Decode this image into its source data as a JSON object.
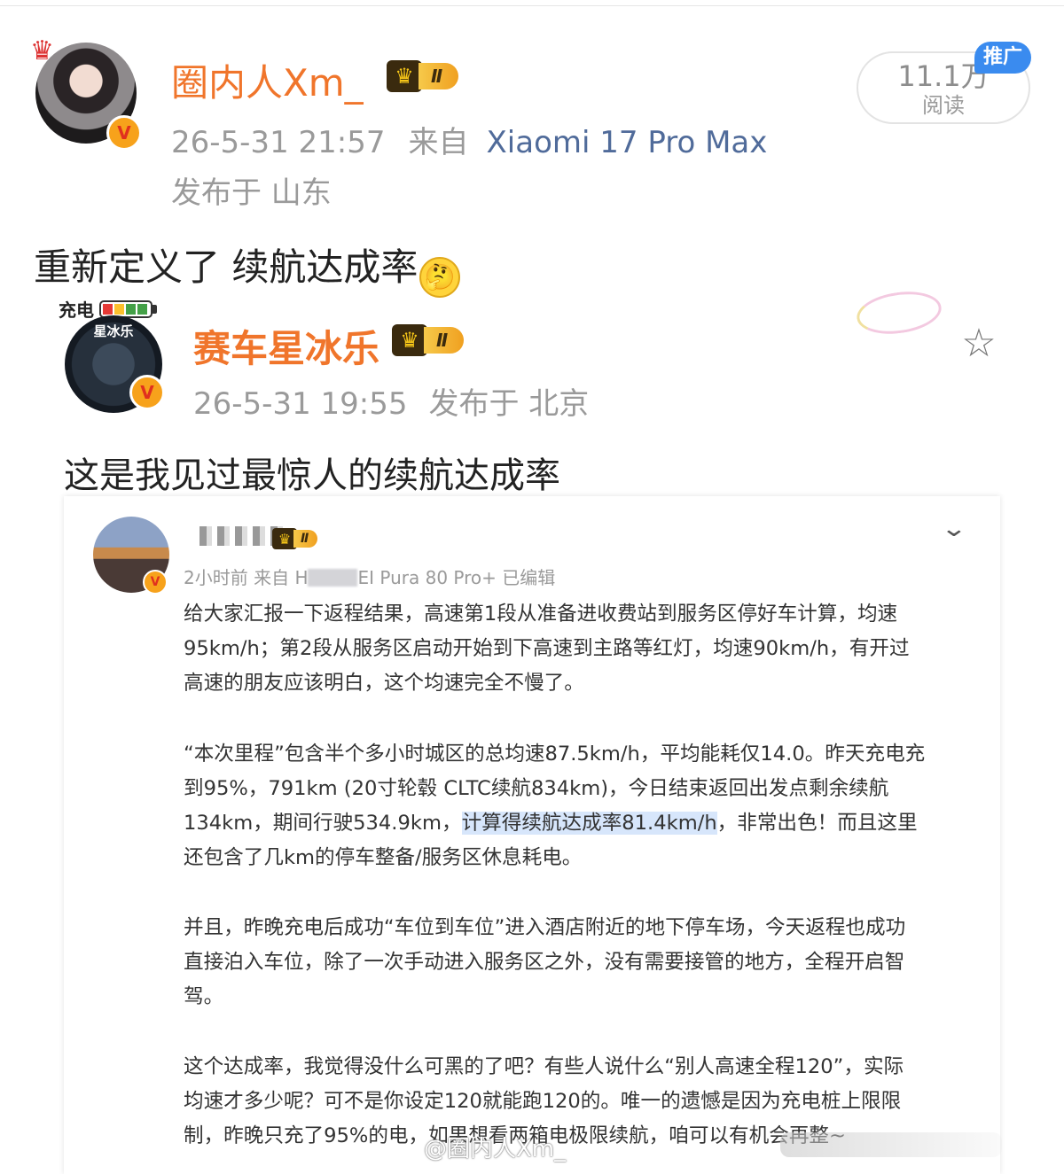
{
  "post": {
    "username": "圈内人Xm_",
    "level": "Ⅱ",
    "verified_mark": "V",
    "timestamp": "26-5-31 21:57",
    "from_label": "来自",
    "device": "Xiaomi 17 Pro Max",
    "location": "发布于 山东",
    "text": "重新定义了 续航达成率",
    "emoji": "thinking-face-emoji",
    "reads_count": "11.1万",
    "reads_label": "阅读",
    "promo_badge": "推广"
  },
  "repost": {
    "charge_label": "充电",
    "avatar_text": "星冰乐",
    "username": "赛车星冰乐",
    "level": "Ⅱ",
    "verified_mark": "V",
    "timestamp": "26-5-31 19:55",
    "location": "发布于 北京",
    "text": "这是我见过最惊人的续航达成率"
  },
  "embedded": {
    "level": "Ⅱ",
    "meta_prefix": "2小时前 来自 H",
    "meta_suffix": "EI Pura 80 Pro+ 已编辑",
    "p1": [
      "给大家汇报一下返程结果，高速第1段从准备进收费站到服务区停好车计算，均速",
      "95km/h；第2段从服务区启动开始到下高速到主路等红灯，均速90km/h，有开过",
      "高速的朋友应该明白，这个均速完全不慢了。"
    ],
    "p2": [
      "“本次里程”包含半个多小时城区的总均速87.5km/h，平均能耗仅14.0。昨天充电充",
      "到95%，791km (20寸轮毂 CLTC续航834km)，今日结束返回出发点剩余续航",
      "134km，期间行驶534.9km，",
      "计算得续航达成率81.4km/h",
      "，非常出色！而且这里",
      "还包含了几km的停车整备/服务区休息耗电。"
    ],
    "p3": [
      "并且，昨晚充电后成功“车位到车位”进入酒店附近的地下停车场，今天返程也成功",
      "直接泊入车位，除了一次手动进入服务区之外，没有需要接管的地方，全程开启智",
      "驾。"
    ],
    "p4": [
      "这个达成率，我觉得没什么可黑的了吧？有些人说什么“别人高速全程120”，实际",
      "均速才多少呢？可不是你设定120就能跑120的。唯一的遗憾是因为充电桩上限限",
      "制，昨晚只充了95%的电，如果想看两箱电极限续航，咱可以有机会再整~"
    ]
  },
  "watermark": "@圈内人Xm_",
  "icons": {
    "star": "star-outline-icon",
    "chevron": "chevron-down-icon",
    "crown": "crown-icon"
  },
  "colors": {
    "username": "#f0752b",
    "device": "#506b9a",
    "meta": "#9a9a9a",
    "promo": "#3a8bef",
    "highlight": "#d7e6fb"
  }
}
